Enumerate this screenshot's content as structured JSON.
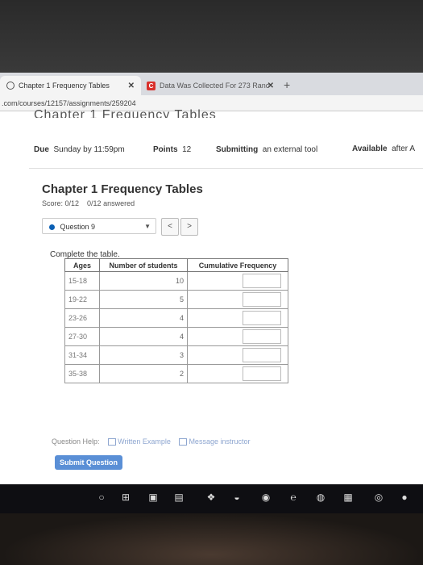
{
  "browser": {
    "tab1_title": "Chapter 1 Frequency Tables",
    "tab2_title": "Data Was Collected For 273 Ranc",
    "url": ".com/courses/12157/assignments/259204"
  },
  "assignment": {
    "cropped_title": "Chapter 1 Frequency Tables",
    "due_label": "Due",
    "due_value": "Sunday by 11:59pm",
    "points_label": "Points",
    "points_value": "12",
    "submitting_label": "Submitting",
    "submitting_value": "an external tool",
    "available_label": "Available",
    "available_value": "after A"
  },
  "quiz": {
    "title": "Chapter 1 Frequency Tables",
    "score": "Score: 0/12",
    "answered": "0/12 answered",
    "question_select": "Question 9",
    "prev": "<",
    "next": ">",
    "instruction": "Complete the table.",
    "columns": [
      "Ages",
      "Number of students",
      "Cumulative Frequency"
    ],
    "rows": [
      {
        "age": "15-18",
        "count": "10"
      },
      {
        "age": "19-22",
        "count": "5"
      },
      {
        "age": "23-26",
        "count": "4"
      },
      {
        "age": "27-30",
        "count": "4"
      },
      {
        "age": "31-34",
        "count": "3"
      },
      {
        "age": "35-38",
        "count": "2"
      }
    ],
    "help_label": "Question Help:",
    "help_written": "Written Example",
    "help_message": "Message instructor",
    "submit_label": "Submit Question"
  }
}
